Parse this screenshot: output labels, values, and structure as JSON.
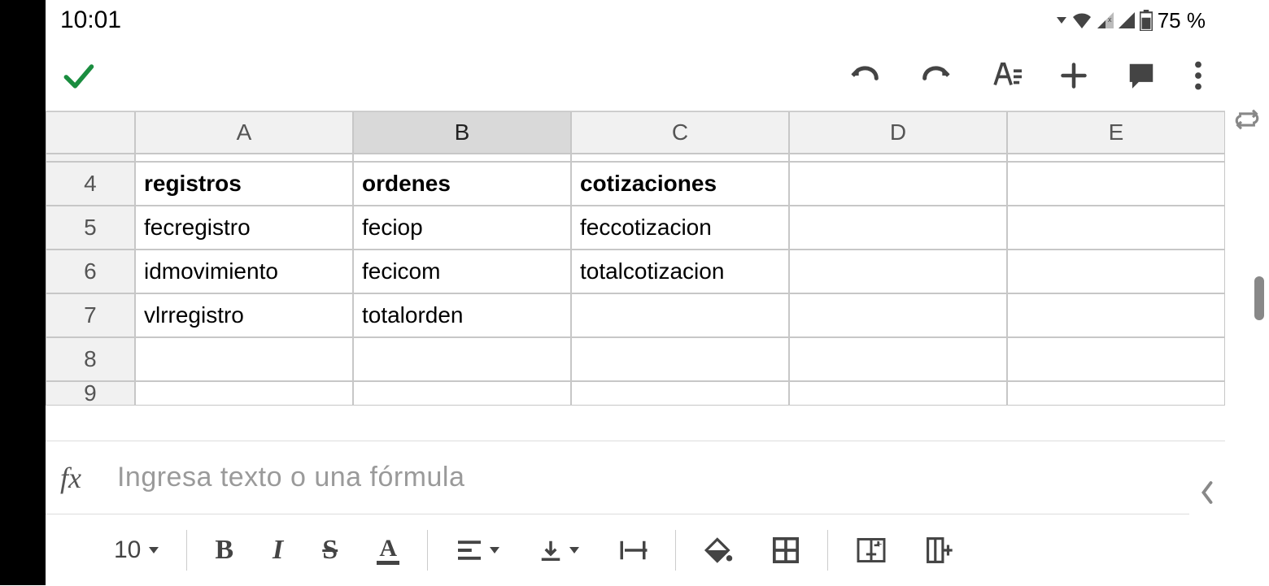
{
  "status": {
    "time": "10:01",
    "battery_pct": "75 %"
  },
  "toolbar": {
    "accept": "✓",
    "undo": "↶",
    "redo": "↷",
    "format": "A",
    "add": "+",
    "comment": "💬",
    "more": "⋮"
  },
  "columns": [
    "A",
    "B",
    "C",
    "D",
    "E"
  ],
  "selected_col": "B",
  "first_row": 4,
  "rows": [
    {
      "n": 4,
      "cells": [
        "registros",
        "ordenes",
        "cotizaciones",
        "",
        ""
      ],
      "bold": true
    },
    {
      "n": 5,
      "cells": [
        "fecregistro",
        "feciop",
        "feccotizacion",
        "",
        ""
      ],
      "bold": false
    },
    {
      "n": 6,
      "cells": [
        "idmovimiento",
        "fecicom",
        "totalcotizacion",
        "",
        ""
      ],
      "bold": false
    },
    {
      "n": 7,
      "cells": [
        "vlrregistro",
        "totalorden",
        "",
        "",
        ""
      ],
      "bold": false
    },
    {
      "n": 8,
      "cells": [
        "",
        "",
        "",
        "",
        ""
      ],
      "bold": false
    },
    {
      "n": 9,
      "cells": [
        "",
        "",
        "",
        "",
        ""
      ],
      "bold": false
    }
  ],
  "formula": {
    "fx": "fx",
    "placeholder": "Ingresa texto o una fórmula"
  },
  "bottom": {
    "font_size": "10",
    "bold": "B",
    "italic": "I",
    "strike": "S",
    "textcolor": "A"
  }
}
